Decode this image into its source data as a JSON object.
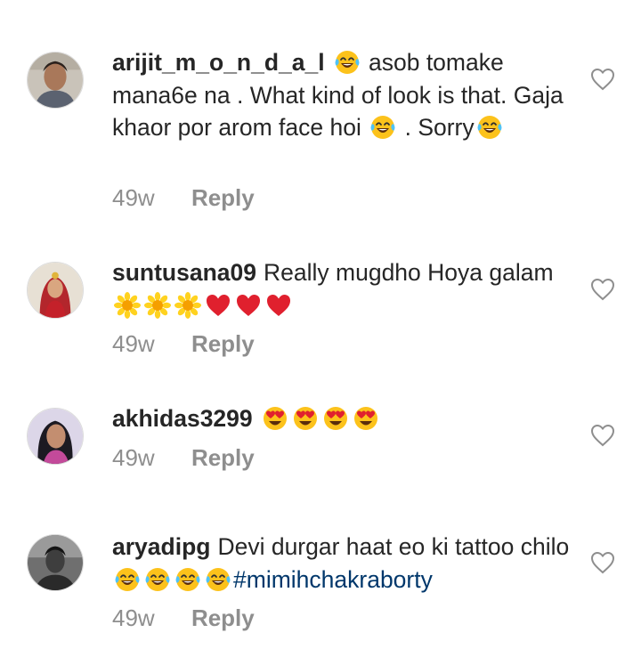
{
  "colors": {
    "text": "#262626",
    "meta": "#8e8e8e",
    "hashtag": "#00376b",
    "background": "#ffffff"
  },
  "comments": [
    {
      "username": "arijit_m_o_n_d_a_l",
      "age": "49w",
      "reply_label": "Reply",
      "segments": [
        {
          "type": "emoji",
          "name": "face-with-tears-of-joy-icon"
        },
        {
          "type": "text",
          "value": " asob tomake mana6e na . What kind of look is that. Gaja khaor por arom face hoi "
        },
        {
          "type": "emoji",
          "name": "face-with-tears-of-joy-icon"
        },
        {
          "type": "text",
          "value": " . Sorry"
        },
        {
          "type": "emoji",
          "name": "face-with-tears-of-joy-icon"
        }
      ]
    },
    {
      "username": "suntusana09",
      "age": "49w",
      "reply_label": "Reply",
      "segments": [
        {
          "type": "text",
          "value": "Really mugdho Hoya galam "
        },
        {
          "type": "emoji",
          "name": "sunflower-icon"
        },
        {
          "type": "emoji",
          "name": "sunflower-icon"
        },
        {
          "type": "emoji",
          "name": "sunflower-icon"
        },
        {
          "type": "emoji",
          "name": "red-heart-icon"
        },
        {
          "type": "emoji",
          "name": "red-heart-icon"
        },
        {
          "type": "emoji",
          "name": "red-heart-icon"
        }
      ]
    },
    {
      "username": "akhidas3299",
      "age": "49w",
      "reply_label": "Reply",
      "segments": [
        {
          "type": "emoji",
          "name": "heart-eyes-face-icon"
        },
        {
          "type": "emoji",
          "name": "heart-eyes-face-icon"
        },
        {
          "type": "emoji",
          "name": "heart-eyes-face-icon"
        },
        {
          "type": "emoji",
          "name": "heart-eyes-face-icon"
        }
      ]
    },
    {
      "username": "aryadipg",
      "age": "49w",
      "reply_label": "Reply",
      "segments": [
        {
          "type": "text",
          "value": "Devi durgar haat eo ki tattoo chilo"
        },
        {
          "type": "emoji",
          "name": "face-with-tears-of-joy-icon"
        },
        {
          "type": "emoji",
          "name": "face-with-tears-of-joy-icon"
        },
        {
          "type": "emoji",
          "name": "face-with-tears-of-joy-icon"
        },
        {
          "type": "emoji",
          "name": "face-with-tears-of-joy-icon"
        },
        {
          "type": "hashtag",
          "value": "#mimihchakraborty"
        }
      ]
    }
  ]
}
